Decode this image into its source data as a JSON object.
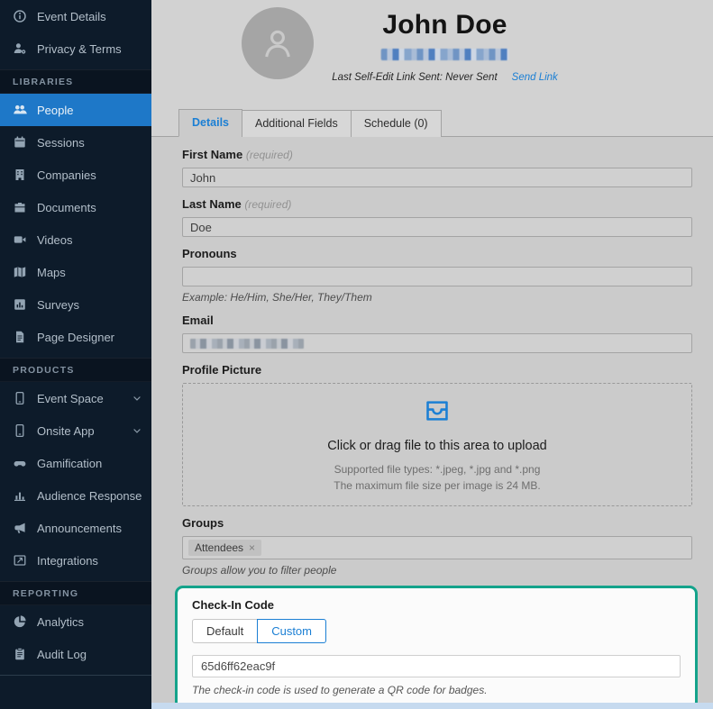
{
  "colors": {
    "sidebar_bg": "#0d1b2a",
    "active_item_blue": "#1e78c8",
    "link_blue": "#1b7fd4",
    "highlight_teal": "#14a38b",
    "footer_bar": "#c6daef"
  },
  "sidebar": {
    "sections": [
      {
        "header": null,
        "items": [
          {
            "id": "event-details",
            "label": "Event Details",
            "icon": "info"
          },
          {
            "id": "privacy-terms",
            "label": "Privacy & Terms",
            "icon": "user-gear"
          }
        ]
      },
      {
        "header": "LIBRARIES",
        "items": [
          {
            "id": "people",
            "label": "People",
            "icon": "users",
            "active": true
          },
          {
            "id": "sessions",
            "label": "Sessions",
            "icon": "calendar"
          },
          {
            "id": "companies",
            "label": "Companies",
            "icon": "building"
          },
          {
            "id": "documents",
            "label": "Documents",
            "icon": "briefcase"
          },
          {
            "id": "videos",
            "label": "Videos",
            "icon": "video"
          },
          {
            "id": "maps",
            "label": "Maps",
            "icon": "map"
          },
          {
            "id": "surveys",
            "label": "Surveys",
            "icon": "survey"
          },
          {
            "id": "page-designer",
            "label": "Page Designer",
            "icon": "page"
          }
        ]
      },
      {
        "header": "PRODUCTS",
        "items": [
          {
            "id": "event-space",
            "label": "Event Space",
            "icon": "phone",
            "expandable": true
          },
          {
            "id": "onsite-app",
            "label": "Onsite App",
            "icon": "phone",
            "expandable": true
          },
          {
            "id": "gamification",
            "label": "Gamification",
            "icon": "game"
          },
          {
            "id": "audience-response",
            "label": "Audience Response",
            "icon": "chart"
          },
          {
            "id": "announcements",
            "label": "Announcements",
            "icon": "megaphone"
          },
          {
            "id": "integrations",
            "label": "Integrations",
            "icon": "integrations"
          }
        ]
      },
      {
        "header": "REPORTING",
        "items": [
          {
            "id": "analytics",
            "label": "Analytics",
            "icon": "pie"
          },
          {
            "id": "audit-log",
            "label": "Audit Log",
            "icon": "clipboard"
          }
        ]
      }
    ]
  },
  "header": {
    "title": "John Doe",
    "meta_label": "Last Self-Edit Link Sent: Never Sent",
    "send_link": "Send Link"
  },
  "tabs": [
    {
      "id": "details",
      "label": "Details",
      "active": true
    },
    {
      "id": "additional-fields",
      "label": "Additional Fields"
    },
    {
      "id": "schedule",
      "label": "Schedule (0)"
    }
  ],
  "form": {
    "first_name": {
      "label": "First Name",
      "required_hint": "(required)",
      "value": "John"
    },
    "last_name": {
      "label": "Last Name",
      "required_hint": "(required)",
      "value": "Doe"
    },
    "pronouns": {
      "label": "Pronouns",
      "value": "",
      "helper": "Example: He/Him, She/Her, They/Them"
    },
    "email": {
      "label": "Email"
    },
    "profile_picture": {
      "label": "Profile Picture",
      "upload_title": "Click or drag file to this area to upload",
      "upload_hint1": "Supported file types: *.jpeg, *.jpg and *.png",
      "upload_hint2": "The maximum file size per image is 24 MB."
    },
    "groups": {
      "label": "Groups",
      "tags": [
        {
          "label": "Attendees"
        }
      ],
      "helper": "Groups allow you to filter people"
    },
    "check_in": {
      "label": "Check-In Code",
      "options": [
        "Default",
        "Custom"
      ],
      "selected": "Custom",
      "value": "65d6ff62eac9f",
      "helper": "The check-in code is used to generate a QR code for badges."
    }
  }
}
